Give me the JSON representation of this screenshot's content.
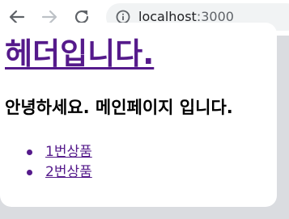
{
  "browser": {
    "url_host": "localhost",
    "url_port": ":3000",
    "icons": {
      "back": "arrow-left-icon",
      "forward": "arrow-right-icon",
      "reload": "reload-icon",
      "info": "info-icon"
    }
  },
  "page": {
    "title": "헤더입니다.",
    "subtitle": "안녕하세요. 메인페이지 입니다.",
    "products": [
      {
        "label": "1번상품"
      },
      {
        "label": "2번상품"
      }
    ]
  },
  "colors": {
    "visited_link": "#551a8b",
    "toolbar_bg": "#ffffff",
    "omnibox_bg": "#f1f3f4"
  }
}
